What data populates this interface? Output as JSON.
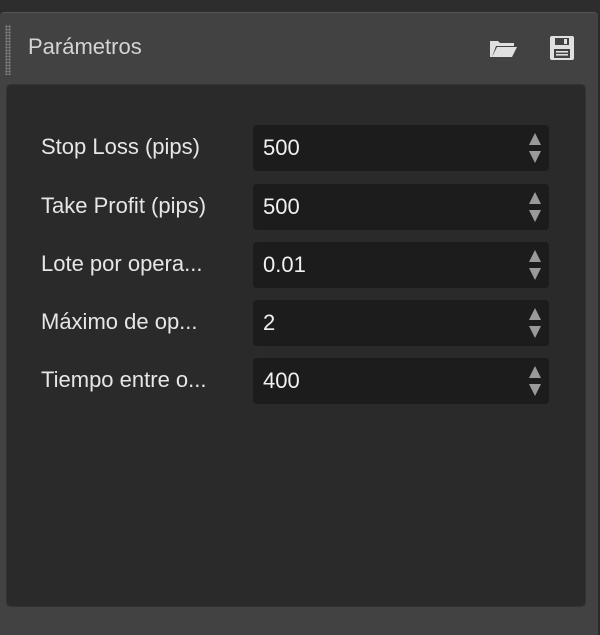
{
  "panel": {
    "title": "Parámetros",
    "icons": {
      "open": "folder-open-icon",
      "save": "floppy-save-icon"
    }
  },
  "params": [
    {
      "label": "Stop Loss (pips)",
      "value": "500"
    },
    {
      "label": "Take Profit (pips)",
      "value": "500"
    },
    {
      "label": "Lote por opera...",
      "value": "0.01"
    },
    {
      "label": "Máximo de op...",
      "value": "2"
    },
    {
      "label": "Tiempo entre o...",
      "value": "400"
    }
  ],
  "colors": {
    "window_bg": "#424242",
    "panel_bg": "#2a2a2a",
    "field_bg": "#1c1c1c",
    "text": "#e6e6e6"
  }
}
